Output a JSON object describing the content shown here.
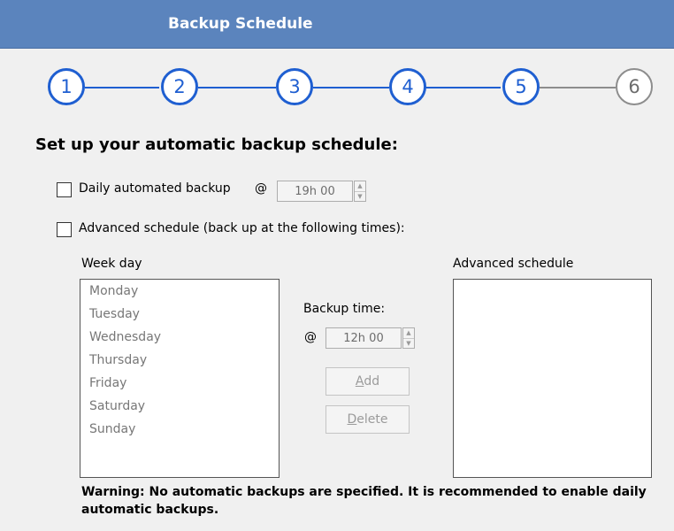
{
  "window": {
    "title": "Backup Schedule"
  },
  "stepper": {
    "steps": [
      {
        "label": "1",
        "state": "done"
      },
      {
        "label": "2",
        "state": "done"
      },
      {
        "label": "3",
        "state": "done"
      },
      {
        "label": "4",
        "state": "done"
      },
      {
        "label": "5",
        "state": "done"
      },
      {
        "label": "6",
        "state": "pending"
      }
    ],
    "active_color": "#1f5fd1",
    "pending_color": "#8d8d8d"
  },
  "heading": "Set up your automatic backup schedule:",
  "daily": {
    "label": "Daily automated backup",
    "at_symbol": "@",
    "time": "19h 00",
    "checked": false
  },
  "advanced": {
    "label": "Advanced schedule (back up at the following times):",
    "checked": false,
    "weekday_header": "Week day",
    "days": [
      "Monday",
      "Tuesday",
      "Wednesday",
      "Thursday",
      "Friday",
      "Saturday",
      "Sunday"
    ],
    "backup_time_label": "Backup time:",
    "at_symbol": "@",
    "time": "12h 00",
    "add_button": {
      "mnemonic": "A",
      "rest": "dd"
    },
    "delete_button": {
      "mnemonic": "D",
      "rest": "elete"
    },
    "schedule_header": "Advanced schedule"
  },
  "warning": "Warning: No automatic backups are specified. It is recommended to enable daily automatic backups."
}
